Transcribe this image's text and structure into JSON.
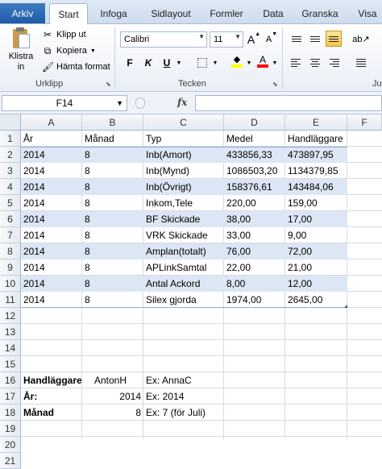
{
  "ribbon": {
    "tabs": [
      {
        "label": "Arkiv"
      },
      {
        "label": "Start"
      },
      {
        "label": "Infoga"
      },
      {
        "label": "Sidlayout"
      },
      {
        "label": "Formler"
      },
      {
        "label": "Data"
      },
      {
        "label": "Granska"
      },
      {
        "label": "Visa"
      }
    ],
    "clipboard": {
      "paste_label": "Klistra in",
      "cut_label": "Klipp ut",
      "copy_label": "Kopiera",
      "format_painter_label": "Hämta format",
      "group_label": "Urklipp"
    },
    "font": {
      "font_name": "Calibri",
      "font_size": "11",
      "bold": "F",
      "italic": "K",
      "underline": "U",
      "grow": "A",
      "shrink": "A",
      "group_label": "Tecken",
      "fill_color": "#ffff00",
      "font_color": "#ff0000"
    },
    "alignment": {
      "group_label": "Ju"
    }
  },
  "formula_bar": {
    "name_box": "F14",
    "fx_label": "fx",
    "formula": ""
  },
  "sheet": {
    "columns": [
      "A",
      "B",
      "C",
      "D",
      "E",
      "F"
    ],
    "rows": [
      "1",
      "2",
      "3",
      "4",
      "5",
      "6",
      "7",
      "8",
      "9",
      "10",
      "11",
      "12",
      "13",
      "14",
      "15",
      "16",
      "17",
      "18",
      "19",
      "20",
      "21"
    ],
    "table_header": [
      "År",
      "Månad",
      "Typ",
      "Medel",
      "Handläggare"
    ],
    "table_rows": [
      [
        "2014",
        "8",
        "Inb(Amort)",
        "433856,33",
        "473897,95"
      ],
      [
        "2014",
        "8",
        "Inb(Mynd)",
        "1086503,20",
        "1134379,85"
      ],
      [
        "2014",
        "8",
        "Inb(Övrigt)",
        "158376,61",
        "143484,06"
      ],
      [
        "2014",
        "8",
        "Inkom,Tele",
        "220,00",
        "159,00"
      ],
      [
        "2014",
        "8",
        "BF Skickade",
        "38,00",
        "17,00"
      ],
      [
        "2014",
        "8",
        "VRK Skickade",
        "33,00",
        "9,00"
      ],
      [
        "2014",
        "8",
        "Amplan(totalt)",
        "76,00",
        "72,00"
      ],
      [
        "2014",
        "8",
        "APLinkSamtal",
        "22,00",
        "21,00"
      ],
      [
        "2014",
        "8",
        "Antal Ackord",
        "8,00",
        "12,00"
      ],
      [
        "2014",
        "8",
        "Silex gjorda",
        "1974,00",
        "2645,00"
      ]
    ],
    "params": [
      {
        "label": "Handläggare",
        "value": "AntonH",
        "example": "Ex: AnnaC"
      },
      {
        "label": "År:",
        "value": "2014",
        "example": "Ex: 2014"
      },
      {
        "label": "Månad",
        "value": "8",
        "example": "Ex: 7 (för Juli)"
      }
    ],
    "band_color": "#dce6f4"
  }
}
